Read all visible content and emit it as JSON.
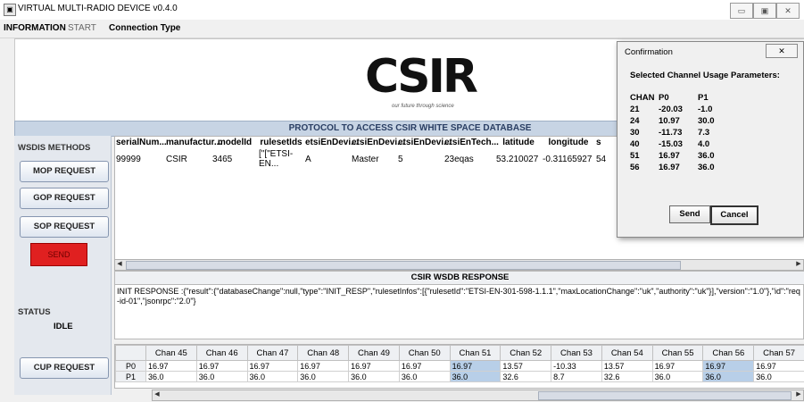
{
  "window": {
    "title": "VIRTUAL MULTI-RADIO DEVICE v0.4.0",
    "controls": [
      "▭",
      "▣",
      "✕"
    ]
  },
  "menu": [
    "INFORMATION",
    "START",
    "Connection Type"
  ],
  "logo": {
    "text": "CSIR",
    "tagline": "our future through science"
  },
  "protocol_title": "PROTOCOL TO ACCESS CSIR WHITE SPACE DATABASE",
  "sidebar": {
    "methods_label": "WSDIS METHODS",
    "buttons": [
      "MOP REQUEST",
      "GOP REQUEST",
      "SOP REQUEST"
    ],
    "send": "SEND",
    "status_label": "STATUS",
    "status_value": "IDLE",
    "cup_button": "CUP REQUEST"
  },
  "device_table": {
    "headers": [
      "serialNum...",
      "manufactur...",
      "modelId",
      "rulesetIds",
      "etsiEnDevi...",
      "etsiEnDevi...",
      "etsiEnDevi...",
      "etsiEnTech...",
      "latitude",
      "longitude",
      "s"
    ],
    "rows": [
      [
        "99999",
        "CSIR",
        "3465",
        "[\"[\"ETSI-EN...",
        "A",
        "Master",
        "5",
        "23eqas",
        "53.210027",
        "-0.31165927",
        "54"
      ]
    ]
  },
  "response": {
    "header": "CSIR WSDB RESPONSE",
    "text": "INIT RESPONSE :{\"result\":{\"databaseChange\":null,\"type\":\"INIT_RESP\",\"rulesetInfos\":[{\"rulesetId\":\"ETSI-EN-301-598-1.1.1\",\"maxLocationChange\":\"uk\",\"authority\":\"uk\"}],\"version\":\"1.0\"},\"id\":\"req-id-01\",\"jsonrpc\":\"2.0\"}"
  },
  "channel_table": {
    "headers": [
      "",
      "Chan 45",
      "Chan 46",
      "Chan 47",
      "Chan 48",
      "Chan 49",
      "Chan 50",
      "Chan 51",
      "Chan 52",
      "Chan 53",
      "Chan 54",
      "Chan 55",
      "Chan 56",
      "Chan 57"
    ],
    "rows": [
      [
        "P0",
        "16.97",
        "16.97",
        "16.97",
        "16.97",
        "16.97",
        "16.97",
        "16.97",
        "13.57",
        "-10.33",
        "13.57",
        "16.97",
        "16.97",
        "16.97"
      ],
      [
        "P1",
        "36.0",
        "36.0",
        "36.0",
        "36.0",
        "36.0",
        "36.0",
        "36.0",
        "32.6",
        "8.7",
        "32.6",
        "36.0",
        "36.0",
        "36.0"
      ]
    ]
  },
  "dialog": {
    "title": "Confirmation",
    "heading": "Selected Channel Usage Parameters:",
    "columns": [
      "CHAN",
      "P0",
      "P1"
    ],
    "rows": [
      [
        "21",
        "-20.03",
        "-1.0"
      ],
      [
        "24",
        "10.97",
        "30.0"
      ],
      [
        "30",
        "-11.73",
        "7.3"
      ],
      [
        "40",
        "-15.03",
        "4.0"
      ],
      [
        "51",
        "16.97",
        "36.0"
      ],
      [
        "56",
        "16.97",
        "36.0"
      ]
    ],
    "send": "Send",
    "cancel": "Cancel",
    "close": "✕"
  },
  "colors": {
    "protocol_bar": "#c7d4e4",
    "send_button": "#e02020",
    "selected_cell": "#b8cfe8"
  }
}
